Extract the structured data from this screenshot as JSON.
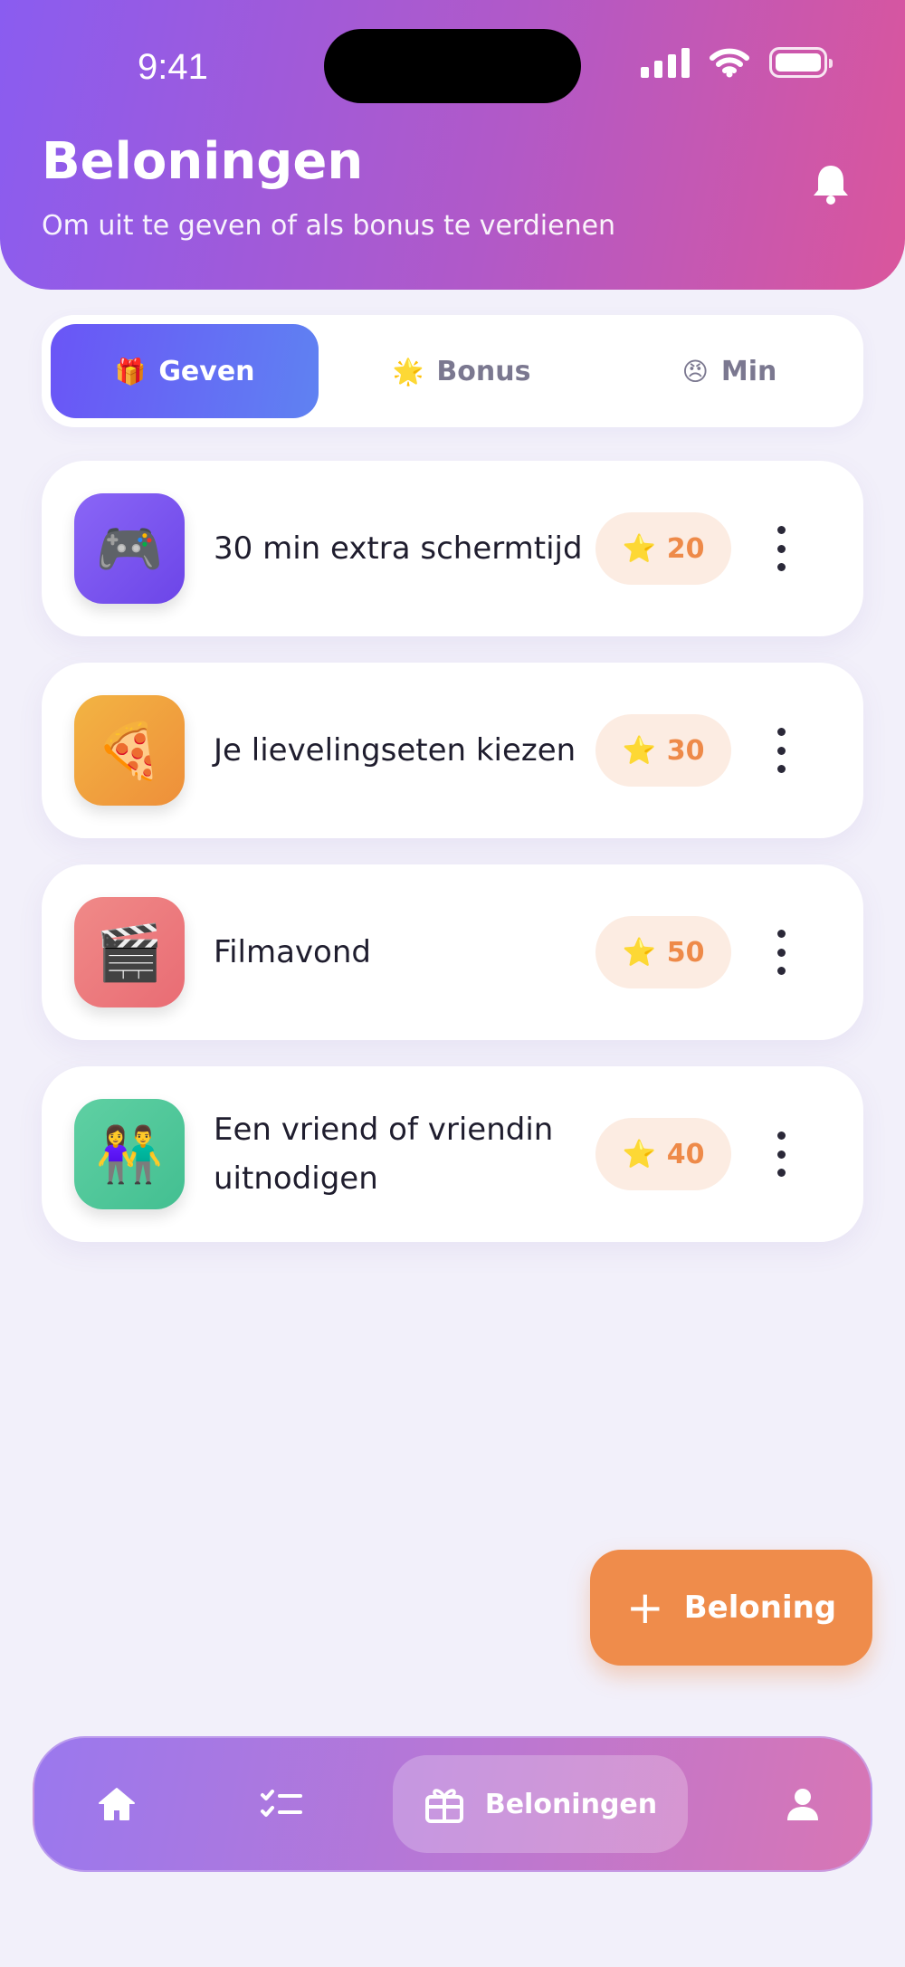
{
  "status_bar": {
    "time": "9:41"
  },
  "header": {
    "title": "Beloningen",
    "subtitle": "Om uit te geven of als bonus te verdienen",
    "bell_icon": "bell-icon"
  },
  "tabs": [
    {
      "emoji": "🎁",
      "label": "Geven",
      "active": true
    },
    {
      "emoji": "🌟",
      "label": "Bonus",
      "active": false
    },
    {
      "emoji": "😠",
      "label": "Min",
      "active": false
    }
  ],
  "rewards": [
    {
      "emoji": "🎮",
      "title": "30 min extra schermtijd",
      "points": "20",
      "tile_color": "#7a55f0"
    },
    {
      "emoji": "🍕",
      "title": "Je lievelingseten kiezen",
      "points": "30",
      "tile_color": "#f0a23e"
    },
    {
      "emoji": "🎬",
      "title": "Filmavond",
      "points": "50",
      "tile_color": "#ec7a7c"
    },
    {
      "emoji": "👫",
      "title": "Een vriend of vriendin uitnodigen",
      "points": "40",
      "tile_color": "#4fc69a"
    }
  ],
  "points_icon": "⭐",
  "fab": {
    "label": "Beloning",
    "icon": "+"
  },
  "bottom_nav": {
    "items": [
      {
        "icon": "home-icon"
      },
      {
        "icon": "checklist-icon"
      },
      {
        "icon": "gift-icon",
        "label": "Beloningen",
        "active": true
      },
      {
        "icon": "profile-icon"
      }
    ]
  },
  "colors": {
    "accent_orange": "#ef8c4b",
    "accent_purple": "#6a55f6",
    "background": "#f2f0fa"
  }
}
